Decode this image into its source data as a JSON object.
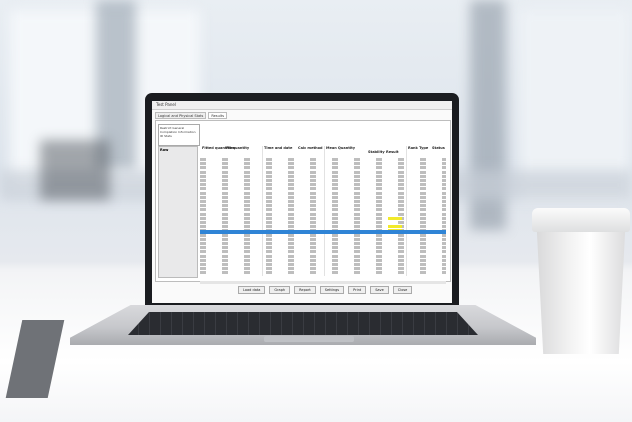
{
  "window": {
    "title": "Test Panel",
    "tabs": [
      "Logical and Physical Stats",
      "Results"
    ],
    "left_list": [
      "Restrict General",
      "Completion Information",
      "ID Stats"
    ],
    "row_header": "Row",
    "columns": [
      "Fitted quantities",
      "Fit quantity",
      "Time and date",
      "Calc method",
      "Mean Quantity",
      "Stability",
      "Result",
      "Rank Type",
      "Status"
    ],
    "buttons": [
      "Load data",
      "Graph",
      "Report",
      "Settings",
      "Print",
      "Save",
      "Close"
    ]
  },
  "colors": {
    "selection": "#2f84d6",
    "highlight": "#f2ea2a",
    "laptop": "#1a1c20"
  }
}
